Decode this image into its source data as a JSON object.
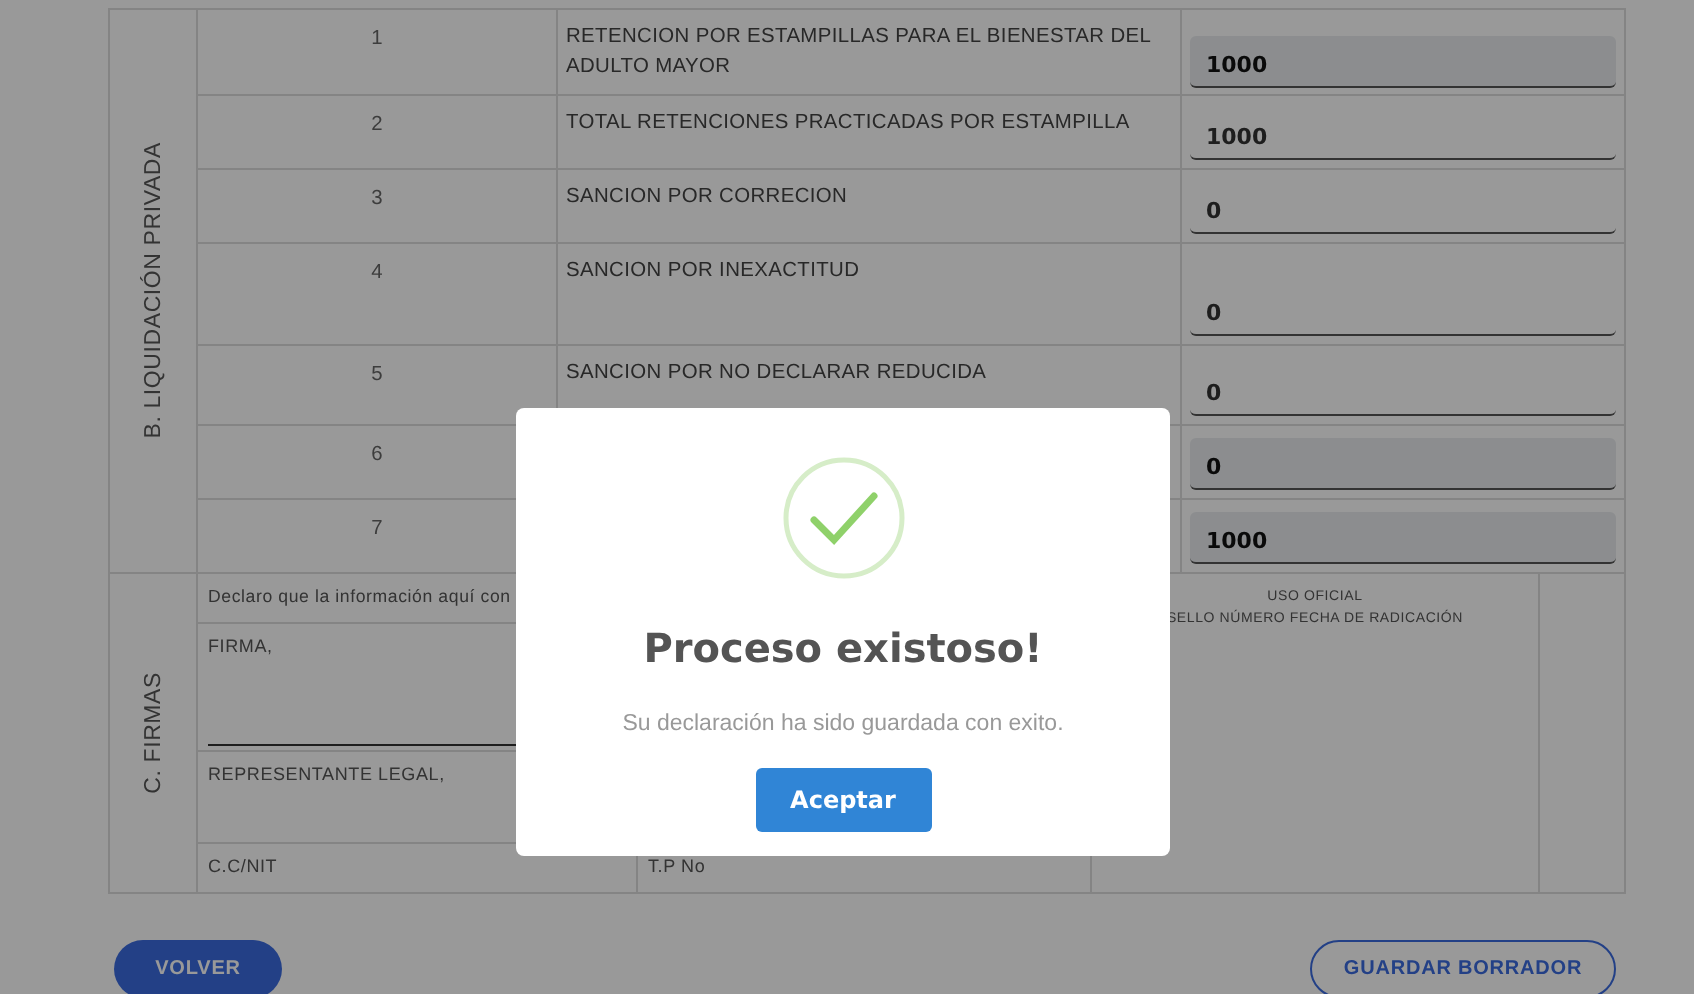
{
  "liquidation": {
    "section_label": "B. LIQUIDACIÓN PRIVADA",
    "rows": [
      {
        "number": "1",
        "concept": "RETENCION POR ESTAMPILLAS PARA EL BIENESTAR DEL ADULTO MAYOR",
        "value": "1000",
        "disabled": true
      },
      {
        "number": "2",
        "concept": "TOTAL RETENCIONES PRACTICADAS POR ESTAMPILLA",
        "value": "1000",
        "disabled": false
      },
      {
        "number": "3",
        "concept": "SANCION POR CORRECION",
        "value": "0",
        "disabled": false
      },
      {
        "number": "4",
        "concept": "SANCION POR INEXACTITUD",
        "value": "0",
        "disabled": false
      },
      {
        "number": "5",
        "concept": "SANCION POR NO DECLARAR REDUCIDA",
        "value": "0",
        "disabled": false
      },
      {
        "number": "6",
        "value": "0",
        "disabled": true
      },
      {
        "number": "7",
        "value": "1000",
        "disabled": true
      }
    ]
  },
  "signatures": {
    "section_label": "C. FIRMAS",
    "declaration": "Declaro que la información aquí con",
    "signature_label": "FIRMA,",
    "legal_rep_label": "REPRESENTANTE LEGAL,",
    "id_label": "C.C/NIT",
    "tp_label": "T.P No",
    "official_use_title": "USO OFICIAL",
    "official_use_caption": "SELLO NÚMERO FECHA DE RADICACIÓN"
  },
  "buttons": [
    {
      "label": "VOLVER",
      "kind": "primary"
    },
    {
      "label": "GUARDAR BORRADOR",
      "kind": "outline"
    }
  ],
  "dialog": {
    "title": "Proceso existoso!",
    "message": "Su declaración ha sido guardada con exito.",
    "button": "Aceptar"
  }
}
